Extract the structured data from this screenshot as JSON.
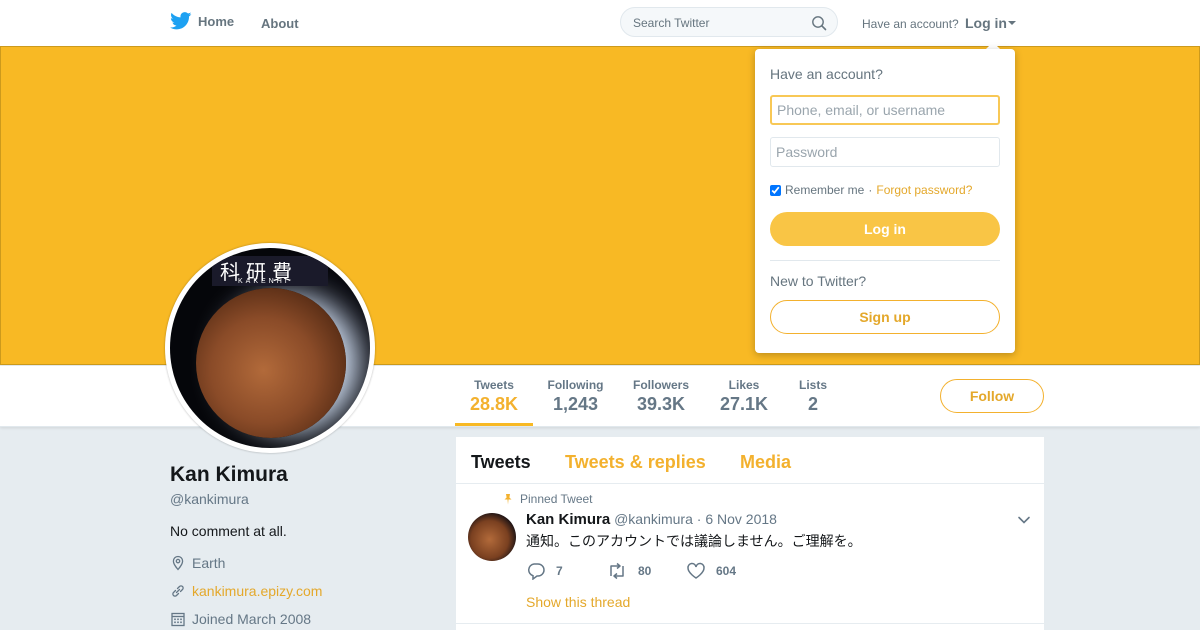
{
  "nav": {
    "home_label": "Home",
    "about_label": "About",
    "search_placeholder": "Search Twitter",
    "have_account": "Have an account?",
    "login_label": "Log in"
  },
  "profile": {
    "name": "Kan Kimura",
    "handle": "@kankimura",
    "bio": "No comment at all.",
    "location": "Earth",
    "website": "kankimura.epizy.com",
    "joined": "Joined March 2008",
    "avatar_text": "科研費",
    "avatar_subtext": "KAKENHI"
  },
  "stats": [
    {
      "label": "Tweets",
      "value": "28.8K"
    },
    {
      "label": "Following",
      "value": "1,243"
    },
    {
      "label": "Followers",
      "value": "39.3K"
    },
    {
      "label": "Likes",
      "value": "27.1K"
    },
    {
      "label": "Lists",
      "value": "2"
    }
  ],
  "follow_label": "Follow",
  "timeline": {
    "tabs": [
      "Tweets",
      "Tweets & replies",
      "Media"
    ],
    "pinned_label": "Pinned Tweet",
    "tweet": {
      "name": "Kan Kimura",
      "handle": "@kankimura",
      "date": "· 6 Nov 2018",
      "text": "通知。このアカウントでは議論しません。ご理解を。",
      "replies": "7",
      "retweets": "80",
      "likes": "604",
      "show_thread": "Show this thread"
    }
  },
  "login_dropdown": {
    "title": "Have an account?",
    "username_placeholder": "Phone, email, or username",
    "password_placeholder": "Password",
    "remember_label": "Remember me",
    "separator": "·",
    "forgot_label": "Forgot password?",
    "login_button": "Log in",
    "new_label": "New to Twitter?",
    "signup_button": "Sign up"
  },
  "colors": {
    "accent": "#f8b924",
    "banner": "#f8b924"
  }
}
